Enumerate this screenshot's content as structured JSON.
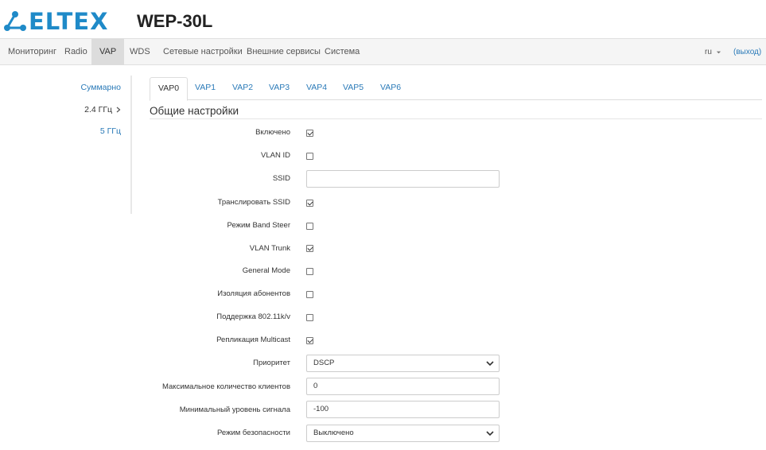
{
  "header": {
    "logo_text": "ELTEX",
    "model": "WEP-30L"
  },
  "nav": {
    "items": [
      "Мониторинг",
      "Radio",
      "VAP",
      "WDS",
      "Сетевые настройки",
      "Внешние сервисы",
      "Система"
    ],
    "active": "VAP",
    "lang": "ru",
    "logout": "(выход)"
  },
  "sidebar": {
    "items": [
      "Суммарно",
      "2.4 ГГц",
      "5 ГГц"
    ],
    "current": "2.4 ГГц"
  },
  "tabs": {
    "items": [
      "VAP0",
      "VAP1",
      "VAP2",
      "VAP3",
      "VAP4",
      "VAP5",
      "VAP6"
    ],
    "active": "VAP0"
  },
  "section": {
    "title": "Общие настройки"
  },
  "form": {
    "enabled": {
      "label": "Включено",
      "checked": true
    },
    "vlan_id": {
      "label": "VLAN ID",
      "checked": false
    },
    "ssid": {
      "label": "SSID",
      "value": ""
    },
    "broadcast_ssid": {
      "label": "Транслировать SSID",
      "checked": true
    },
    "band_steer": {
      "label": "Режим Band Steer",
      "checked": false
    },
    "vlan_trunk": {
      "label": "VLAN Trunk",
      "checked": true
    },
    "general_mode": {
      "label": "General Mode",
      "checked": false
    },
    "station_isolation": {
      "label": "Изоляция абонентов",
      "checked": false
    },
    "support_80211kv": {
      "label": "Поддержка 802.11k/v",
      "checked": false
    },
    "multicast_replication": {
      "label": "Репликация Multicast",
      "checked": true
    },
    "priority": {
      "label": "Приоритет",
      "value": "DSCP"
    },
    "max_clients": {
      "label": "Максимальное количество клиентов",
      "value": "0"
    },
    "min_signal": {
      "label": "Минимальный уровень сигнала",
      "value": "-100"
    },
    "security_mode": {
      "label": "Режим безопасности",
      "value": "Выключено"
    }
  },
  "colors": {
    "brand": "#1f8ac8",
    "link": "#2a7ab8",
    "nav_active_bg": "#dcdcdc"
  }
}
